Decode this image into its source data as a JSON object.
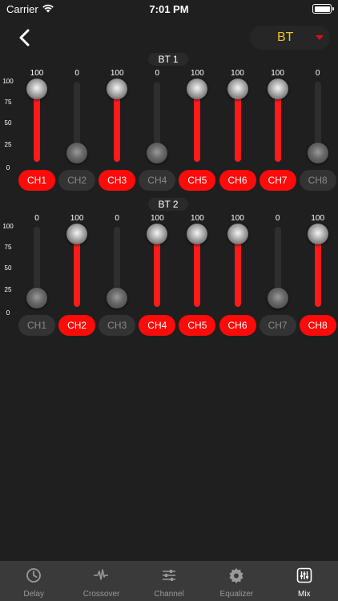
{
  "status_bar": {
    "carrier": "Carrier",
    "time": "7:01 PM"
  },
  "header": {
    "source_value": "BT",
    "icons": [
      "back-chevron-icon",
      "dropdown-arrow-icon"
    ]
  },
  "axis_labels": [
    "100",
    "75",
    "50",
    "25",
    "0"
  ],
  "colors": {
    "accent": "#ff0a0a",
    "source": "#e8c22b",
    "off": "#333333"
  },
  "groups": [
    {
      "title": "BT 1",
      "channels": [
        {
          "label": "CH1",
          "value": 100,
          "value_text": "100",
          "on": true
        },
        {
          "label": "CH2",
          "value": 0,
          "value_text": "0",
          "on": false
        },
        {
          "label": "CH3",
          "value": 100,
          "value_text": "100",
          "on": true
        },
        {
          "label": "CH4",
          "value": 0,
          "value_text": "0",
          "on": false
        },
        {
          "label": "CH5",
          "value": 100,
          "value_text": "100",
          "on": true
        },
        {
          "label": "CH6",
          "value": 100,
          "value_text": "100",
          "on": true
        },
        {
          "label": "CH7",
          "value": 100,
          "value_text": "100",
          "on": true
        },
        {
          "label": "CH8",
          "value": 0,
          "value_text": "0",
          "on": false
        }
      ]
    },
    {
      "title": "BT 2",
      "channels": [
        {
          "label": "CH1",
          "value": 0,
          "value_text": "0",
          "on": false
        },
        {
          "label": "CH2",
          "value": 100,
          "value_text": "100",
          "on": true
        },
        {
          "label": "CH3",
          "value": 0,
          "value_text": "0",
          "on": false
        },
        {
          "label": "CH4",
          "value": 100,
          "value_text": "100",
          "on": true
        },
        {
          "label": "CH5",
          "value": 100,
          "value_text": "100",
          "on": true
        },
        {
          "label": "CH6",
          "value": 100,
          "value_text": "100",
          "on": true
        },
        {
          "label": "CH7",
          "value": 0,
          "value_text": "0",
          "on": false
        },
        {
          "label": "CH8",
          "value": 100,
          "value_text": "100",
          "on": true
        }
      ]
    }
  ],
  "tabs": [
    {
      "label": "Delay",
      "icon": "clock-icon",
      "active": false
    },
    {
      "label": "Crossover",
      "icon": "waveform-icon",
      "active": false
    },
    {
      "label": "Channel",
      "icon": "sliders-icon",
      "active": false
    },
    {
      "label": "Equalizer",
      "icon": "gear-icon",
      "active": false
    },
    {
      "label": "Mix",
      "icon": "mixer-icon",
      "active": true
    }
  ]
}
